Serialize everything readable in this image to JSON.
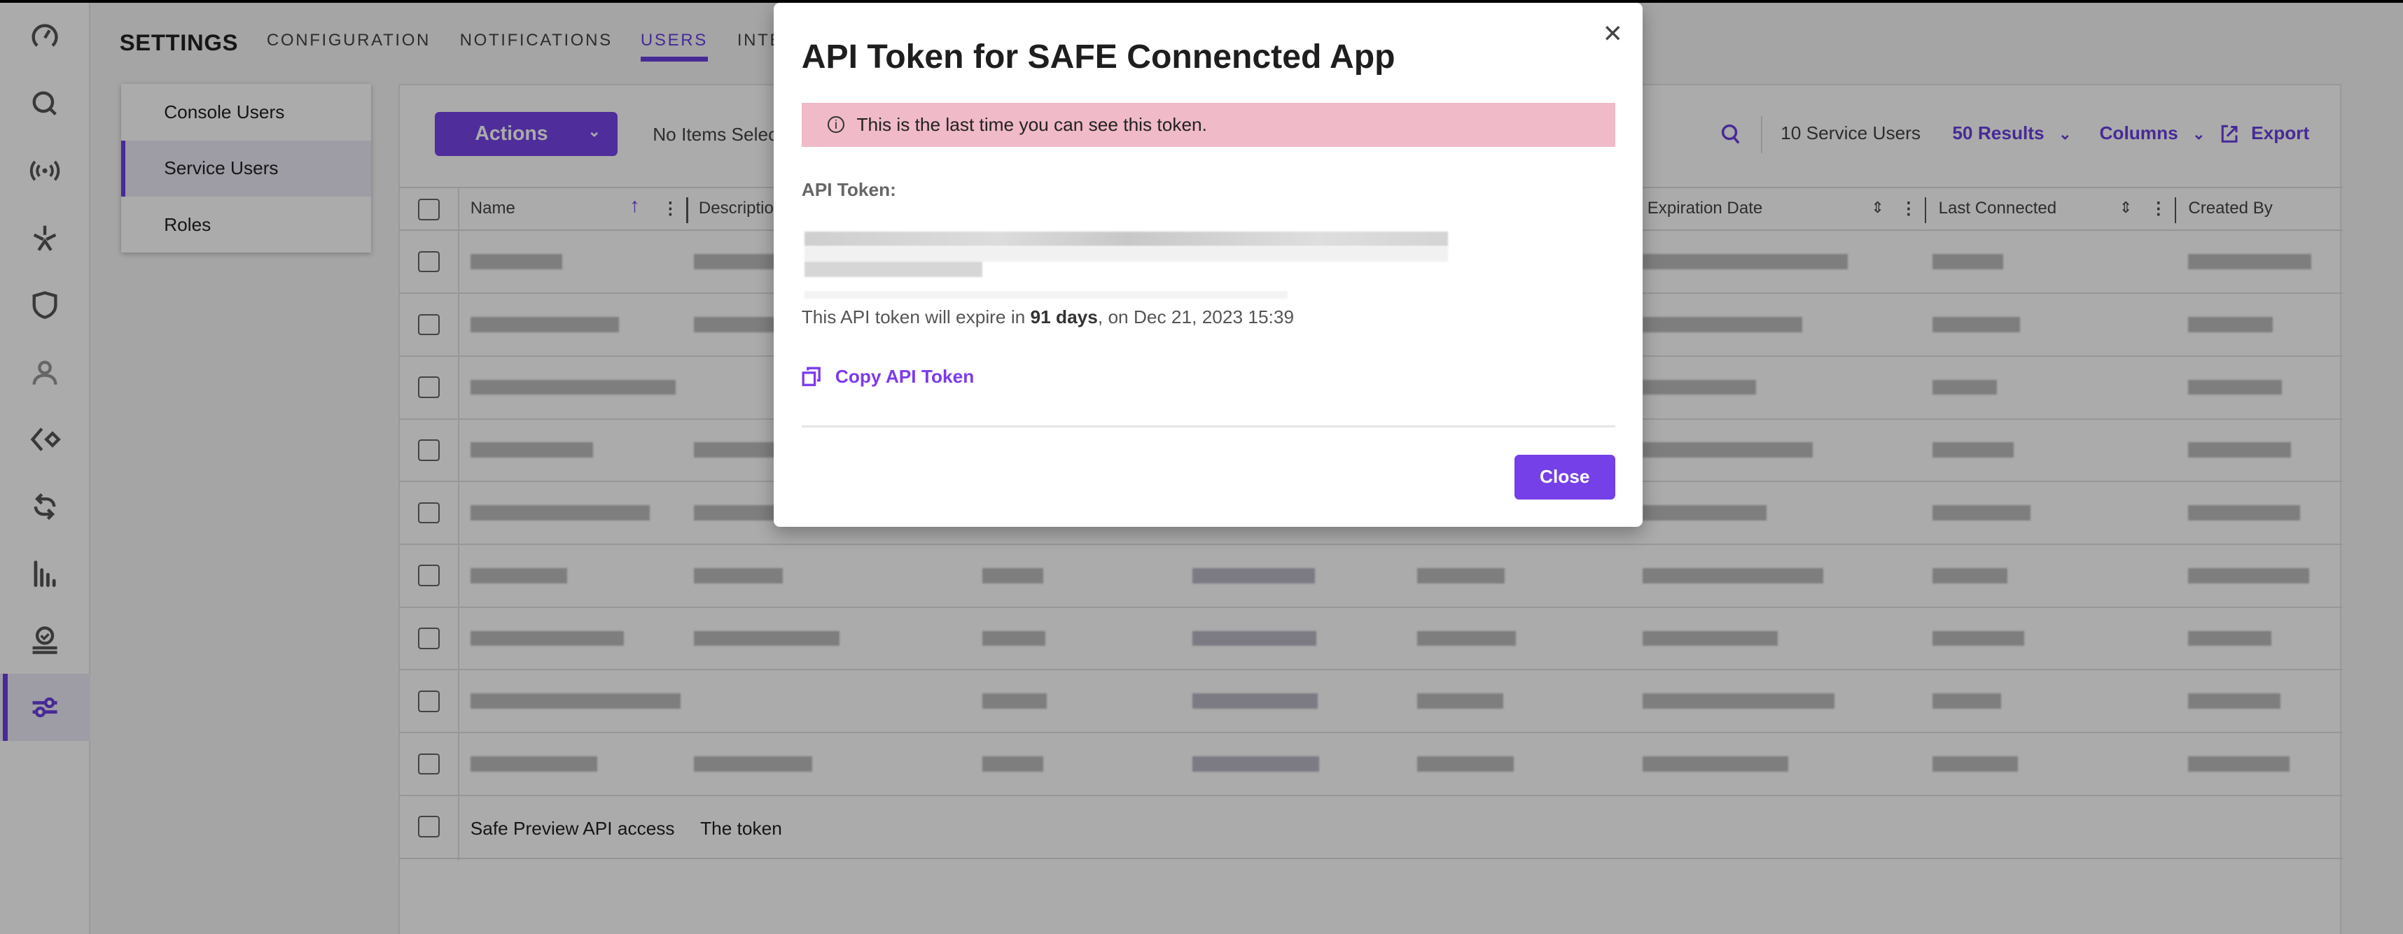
{
  "rail": {
    "items": [
      {
        "icon": "gauge-icon"
      },
      {
        "icon": "search-icon"
      },
      {
        "icon": "broadcast-icon"
      },
      {
        "icon": "asterisk-icon"
      },
      {
        "icon": "shield-icon"
      },
      {
        "icon": "user-icon"
      },
      {
        "icon": "diamond-code-icon"
      },
      {
        "icon": "sync-icon"
      },
      {
        "icon": "bar-chart-icon"
      },
      {
        "icon": "badge-check-icon"
      },
      {
        "icon": "sliders-icon",
        "active": true
      }
    ]
  },
  "header": {
    "title": "SETTINGS",
    "tabs": [
      {
        "label": "CONFIGURATION"
      },
      {
        "label": "NOTIFICATIONS"
      },
      {
        "label": "USERS",
        "active": true
      },
      {
        "label": "INTEGRATIONS"
      }
    ]
  },
  "subnav": {
    "items": [
      {
        "label": "Console Users"
      },
      {
        "label": "Service Users",
        "active": true
      },
      {
        "label": "Roles"
      }
    ]
  },
  "toolbar": {
    "actions_label": "Actions",
    "selection_status": "No Items Selected",
    "count": "10 Service Users",
    "results": "50 Results",
    "columns": "Columns",
    "export": "Export"
  },
  "table": {
    "columns": [
      "Name",
      "Description",
      "Expiration Date",
      "Last Connected",
      "Created By"
    ],
    "last_row": {
      "name": "Safe Preview API access",
      "description": "The token"
    }
  },
  "modal": {
    "title": "API Token for SAFE Connencted App",
    "alert": "This is the last time you can see this token.",
    "token_label": "API Token:",
    "expire_prefix": "This API token will expire in ",
    "expire_days": "91 days",
    "expire_suffix": ", on Dec 21, 2023 15:39",
    "copy_label": "Copy API Token",
    "close_label": "Close"
  },
  "colors": {
    "accent": "#6a3fe0",
    "alert_bg": "#f0bac8",
    "button": "#7540e8"
  }
}
